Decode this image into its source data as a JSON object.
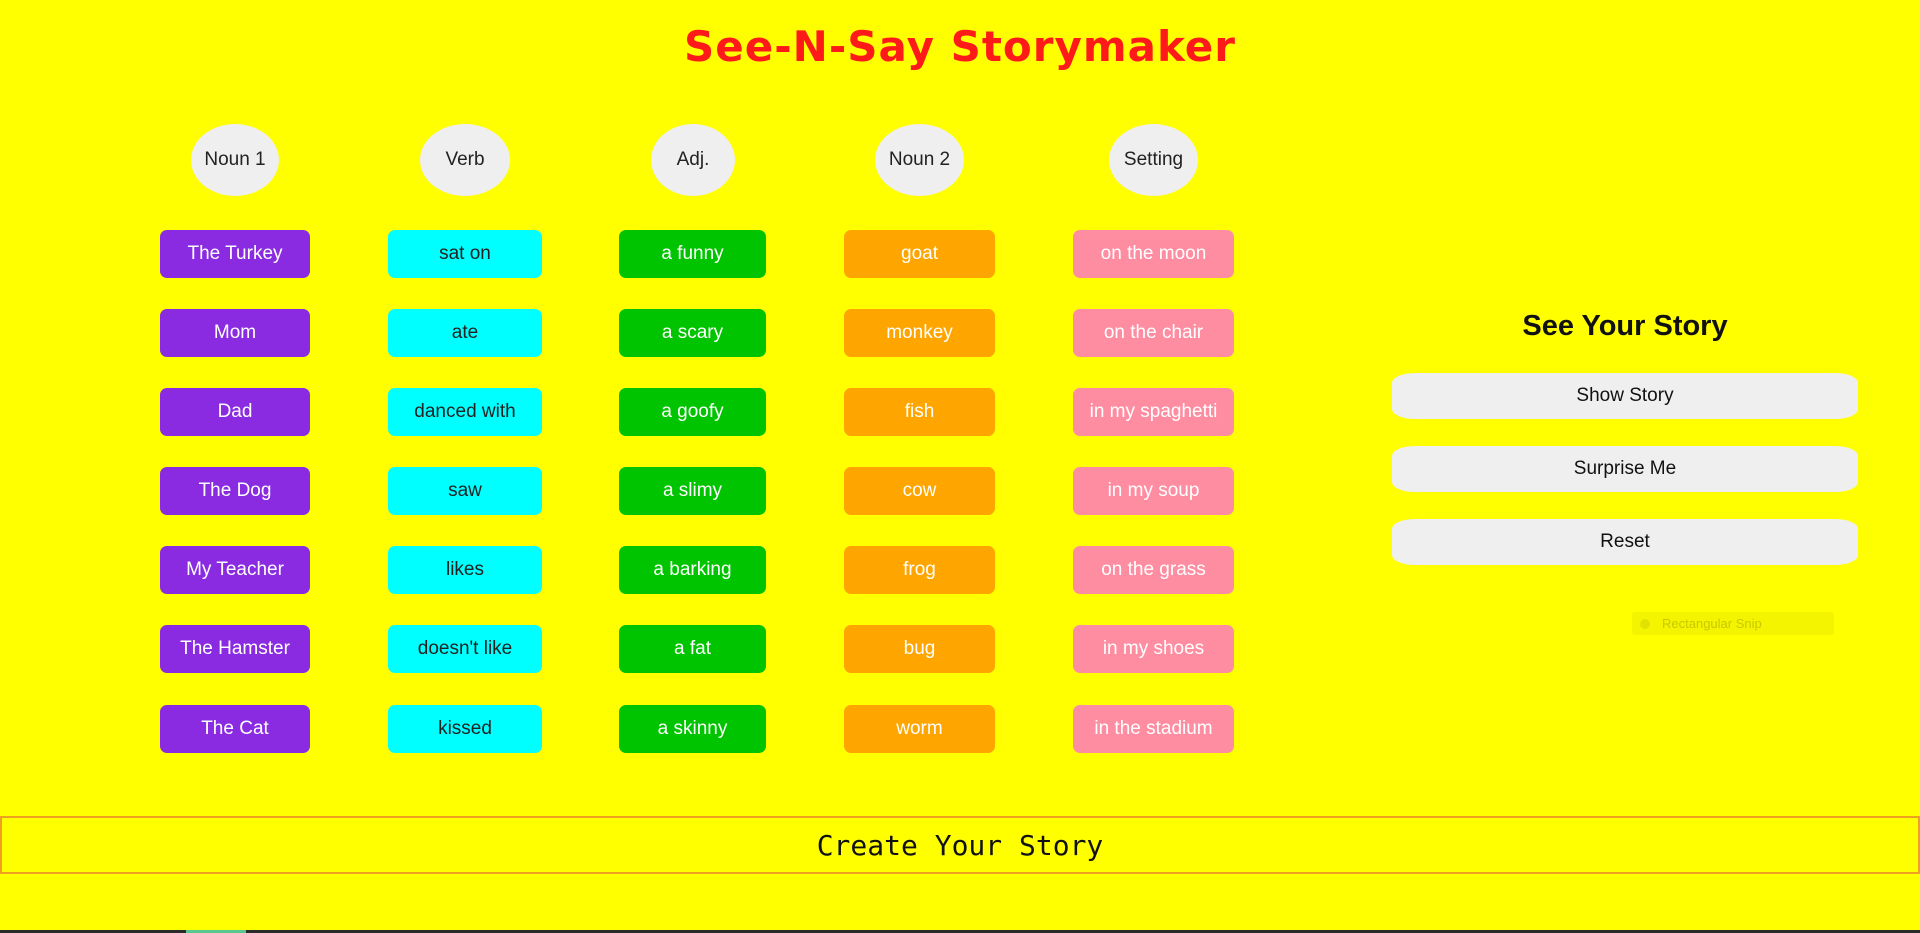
{
  "app": {
    "title": "See-N-Say Storymaker"
  },
  "columns": [
    {
      "header": "Noun 1",
      "items": [
        "The Turkey",
        "Mom",
        "Dad",
        "The Dog",
        "My Teacher",
        "The Hamster",
        "The Cat"
      ]
    },
    {
      "header": "Verb",
      "items": [
        "sat on",
        "ate",
        "danced with",
        "saw",
        "likes",
        "doesn't like",
        "kissed"
      ]
    },
    {
      "header": "Adj.",
      "items": [
        "a funny",
        "a scary",
        "a goofy",
        "a slimy",
        "a barking",
        "a fat",
        "a skinny"
      ]
    },
    {
      "header": "Noun 2",
      "items": [
        "goat",
        "monkey",
        "fish",
        "cow",
        "frog",
        "bug",
        "worm"
      ]
    },
    {
      "header": "Setting",
      "items": [
        "on the moon",
        "on the chair",
        "in my spaghetti",
        "in my soup",
        "on the grass",
        "in my shoes",
        "in the stadium"
      ]
    }
  ],
  "story_panel": {
    "heading": "See Your Story",
    "show_label": "Show Story",
    "surprise_label": "Surprise Me",
    "reset_label": "Reset"
  },
  "overlay": {
    "snip_label": "Rectangular Snip"
  },
  "create_bar": {
    "label": "Create Your Story"
  },
  "colors": {
    "background": "#ffff00",
    "title": "#ff1a1a",
    "noun1": "#8a2be2",
    "verb": "#00ffff",
    "adjective": "#00c400",
    "noun2": "#ffa500",
    "setting": "#ff8da1"
  }
}
